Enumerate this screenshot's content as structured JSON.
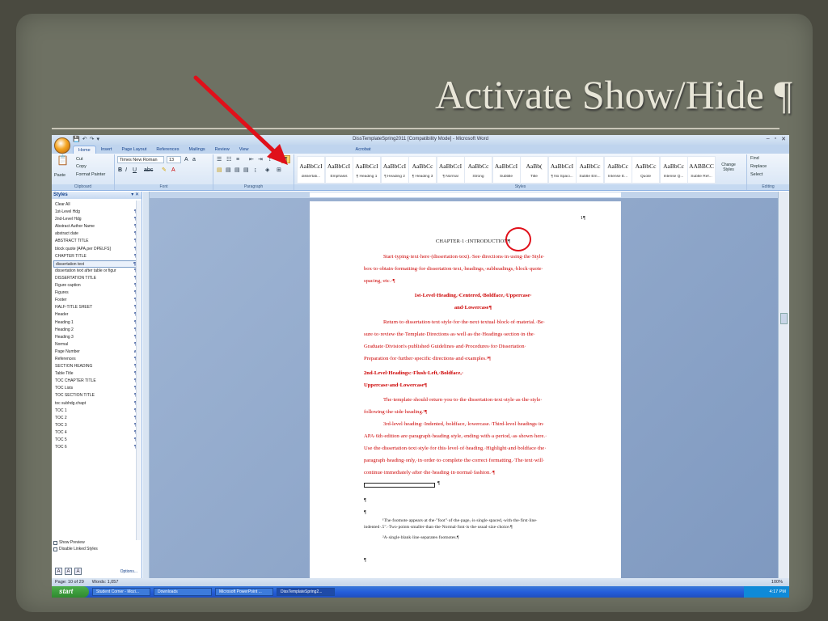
{
  "slide": {
    "title": "Activate Show/Hide ¶"
  },
  "window": {
    "title": "DissTemplateSpring2011 [Compatibility Mode] - Microsoft Word",
    "controls": [
      "–",
      "▫",
      "✕"
    ],
    "qat": [
      "💾",
      "↶",
      "↷",
      "▾"
    ]
  },
  "tabs": [
    "Home",
    "Insert",
    "Page Layout",
    "References",
    "Mailings",
    "Review",
    "View",
    "Acrobat"
  ],
  "ribbon": {
    "clipboard": {
      "paste": "Paste",
      "cut": "Cut",
      "copy": "Copy",
      "format_painter": "Format Painter",
      "label": "Clipboard"
    },
    "font": {
      "name": "Times New Roman",
      "size": "13",
      "label": "Font"
    },
    "paragraph": {
      "label": "Paragraph",
      "show_hide": "¶"
    },
    "styles": {
      "label": "Styles",
      "tiles": [
        {
          "sample": "AaBbCcI",
          "name": "dissertati..."
        },
        {
          "sample": "AaBbCcI",
          "name": "Emphasis"
        },
        {
          "sample": "AaBbCcI",
          "name": "¶ Heading 1"
        },
        {
          "sample": "AaBbCcI",
          "name": "¶ Heading 2"
        },
        {
          "sample": "AaBbCc",
          "name": "¶ Heading 3"
        },
        {
          "sample": "AaBbCcI",
          "name": "¶ Normal"
        },
        {
          "sample": "AaBbCc",
          "name": "Strong"
        },
        {
          "sample": "AaBbCcI",
          "name": "Subtitle"
        },
        {
          "sample": "AaBb(",
          "name": "Title"
        },
        {
          "sample": "AaBbCcI",
          "name": "¶ No Spaci..."
        },
        {
          "sample": "AaBbCc",
          "name": "Subtle Em..."
        },
        {
          "sample": "AaBbCc",
          "name": "Intense E..."
        },
        {
          "sample": "AaBbCc",
          "name": "Quote"
        },
        {
          "sample": "AaBbCc",
          "name": "Intense Q..."
        },
        {
          "sample": "AABBCC",
          "name": "Subtle Ref..."
        }
      ],
      "change_styles": "Change Styles"
    },
    "editing": {
      "find": "Find",
      "replace": "Replace",
      "select": "Select",
      "label": "Editing"
    }
  },
  "styles_pane": {
    "title": "Styles",
    "items": [
      {
        "name": "Clear All",
        "mark": ""
      },
      {
        "name": "1st-Level Hdg",
        "mark": "¶"
      },
      {
        "name": "2nd-Level Hdg",
        "mark": "¶"
      },
      {
        "name": "Abstract Author Name",
        "mark": "¶"
      },
      {
        "name": "abstract date",
        "mark": "¶"
      },
      {
        "name": "ABSTRACT TITLE",
        "mark": "¶"
      },
      {
        "name": "block quote [APA,per DPELFS]",
        "mark": "¶"
      },
      {
        "name": "CHAPTER TITLE",
        "mark": "¶"
      },
      {
        "name": "dissertation text",
        "mark": "¶"
      },
      {
        "name": "dissertation text after table or figur",
        "mark": "¶"
      },
      {
        "name": "DISSERTATION TITLE",
        "mark": "¶"
      },
      {
        "name": "Figure caption",
        "mark": "¶"
      },
      {
        "name": "Figures",
        "mark": "¶"
      },
      {
        "name": "Footer",
        "mark": "¶"
      },
      {
        "name": "HALF-TITLE SHEET",
        "mark": "¶"
      },
      {
        "name": "Header",
        "mark": "¶"
      },
      {
        "name": "Heading 1",
        "mark": "¶"
      },
      {
        "name": "Heading 2",
        "mark": "¶"
      },
      {
        "name": "Heading 3",
        "mark": "¶"
      },
      {
        "name": "Normal",
        "mark": "¶"
      },
      {
        "name": "Page Number",
        "mark": "a"
      },
      {
        "name": "References",
        "mark": "¶"
      },
      {
        "name": "SECTION HEADING",
        "mark": "¶"
      },
      {
        "name": "Table Title",
        "mark": "¶"
      },
      {
        "name": "TOC CHAPTER TITLE",
        "mark": "¶"
      },
      {
        "name": "TOC Lists",
        "mark": "¶"
      },
      {
        "name": "TOC SECTION TITLE",
        "mark": "¶"
      },
      {
        "name": "toc subhdg.chapt",
        "mark": "¶"
      },
      {
        "name": "TOC 1",
        "mark": "¶"
      },
      {
        "name": "TOC 2",
        "mark": "¶"
      },
      {
        "name": "TOC 3",
        "mark": "¶"
      },
      {
        "name": "TOC 4",
        "mark": "¶"
      },
      {
        "name": "TOC 5",
        "mark": "¶"
      },
      {
        "name": "TOC 6",
        "mark": "¶"
      }
    ],
    "show_preview": "Show Preview",
    "disable_linked": "Disable Linked Styles",
    "options": "Options..."
  },
  "document": {
    "page_number": "1¶",
    "chapter": "CHAPTER·1·:INTRODUCTION¶",
    "lines": [
      "Start·typing·text·here·(dissertation·text).·See·directions·in·using·the·Style·",
      "box·to·obtain·formatting·for·dissertation·text,·headings,·subheadings,·block·quote·",
      "spacing,·etc.·¶",
      "1st-Level·Heading,·Centered,·Boldface,·Uppercase·",
      "and·Lowercase¶",
      "Return·to·dissertation·text·style·for·the·next·textual·block·of·material.·Be·",
      "sure·to·review·the·Template·Directions·as·well·as·the·Headings·section·in·the·",
      "Graduate·Division's·published·Guidelines·and·Procedures·for·Dissertation·",
      "Preparation·for·further·specific·directions·and·examples.¹¶",
      "2nd-Level·Headings:·Flush·Left,·Boldface,·",
      "Uppercase·and·Lowercase¶",
      "The·template·should·return·you·to·the·dissertation·text·style·as·the·style·",
      "following·the·side·heading.²¶",
      "3rd-level·heading:·Indented,·boldface,·lowercase.·Third-level·headings·in·",
      "APA·6th·edition·are·paragraph·heading·style,·ending·with·a·period,·as·shown·here.·",
      "Use·the·dissertation·text·style·for·this·level·of·heading.·Highlight·and·boldface·the·",
      "paragraph·heading·only,·in·order·to·complete·the·correct·formatting.·The·text·will·",
      "continue·immediately·after·the·heading·in·normal·fashion.·¶"
    ],
    "footnote_sep": "¶",
    "blank1": "¶",
    "blank2": "¶",
    "footnote1a": "¹The·footnote·appears·at·the·\"foot\"·of·the·page,·is·single·spaced,·with·the·first·line·",
    "footnote1b": "indented·.5\".·Two·points·smaller·than·the·Normal·font·is·the·usual·size·choice.¶",
    "footnote2": "²A·single·blank·line·separates·footnotes.¶",
    "blank3": "¶"
  },
  "statusbar": {
    "page": "Page: 10 of 29",
    "words": "Words: 1,057",
    "zoom": "100%"
  },
  "taskbar": {
    "start": "start",
    "tasks": [
      "Student Corner - Mozi...",
      "Downloads",
      "Microsoft PowerPoint ...",
      "DissTemplateSpring2..."
    ],
    "time": "4:17 PM"
  },
  "colors": {
    "slide_bg": "#6e7163",
    "title_text": "#e8e6d8",
    "arrow": "#e0101a",
    "doc_text": "#c00000"
  }
}
